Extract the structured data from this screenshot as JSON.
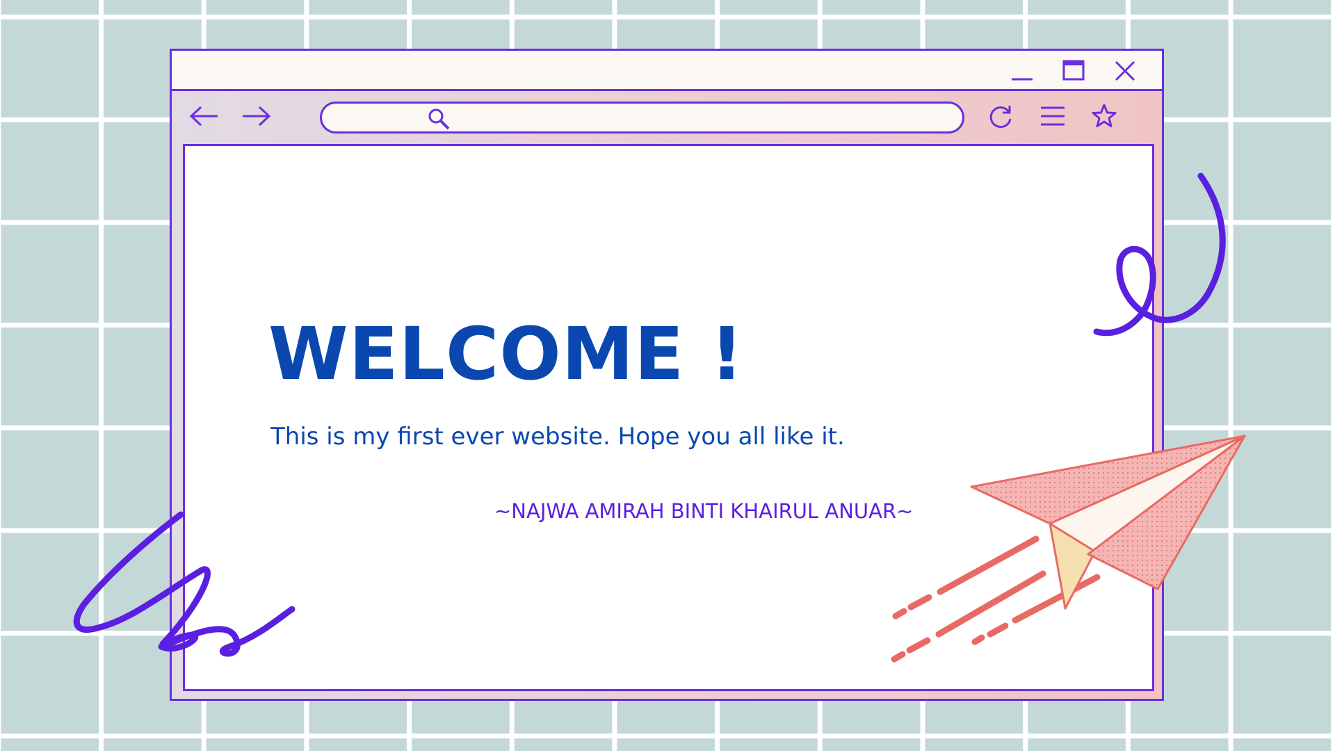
{
  "window": {
    "minimize_icon": "minimize-icon",
    "maximize_icon": "maximize-icon",
    "close_icon": "close-icon"
  },
  "toolbar": {
    "back_icon": "arrow-left-icon",
    "forward_icon": "arrow-right-icon",
    "search_icon": "search-icon",
    "address_value": "",
    "reload_icon": "reload-icon",
    "menu_icon": "hamburger-menu-icon",
    "bookmark_icon": "star-icon"
  },
  "page": {
    "heading": "WELCOME !",
    "subtitle": "This is my first ever website. Hope you all like it.",
    "author": "~NAJWA AMIRAH BINTI KHAIRUL ANUAR~"
  },
  "decorations": [
    "purple-scribble-right",
    "purple-scribble-left",
    "paper-plane-illustration"
  ],
  "colors": {
    "background_grid": "#c4d9d7",
    "accent_purple": "#6b2ee0",
    "heading_blue": "#0a48b0",
    "plane_coral": "#e86a64",
    "plane_pink": "#f4b5b3"
  }
}
